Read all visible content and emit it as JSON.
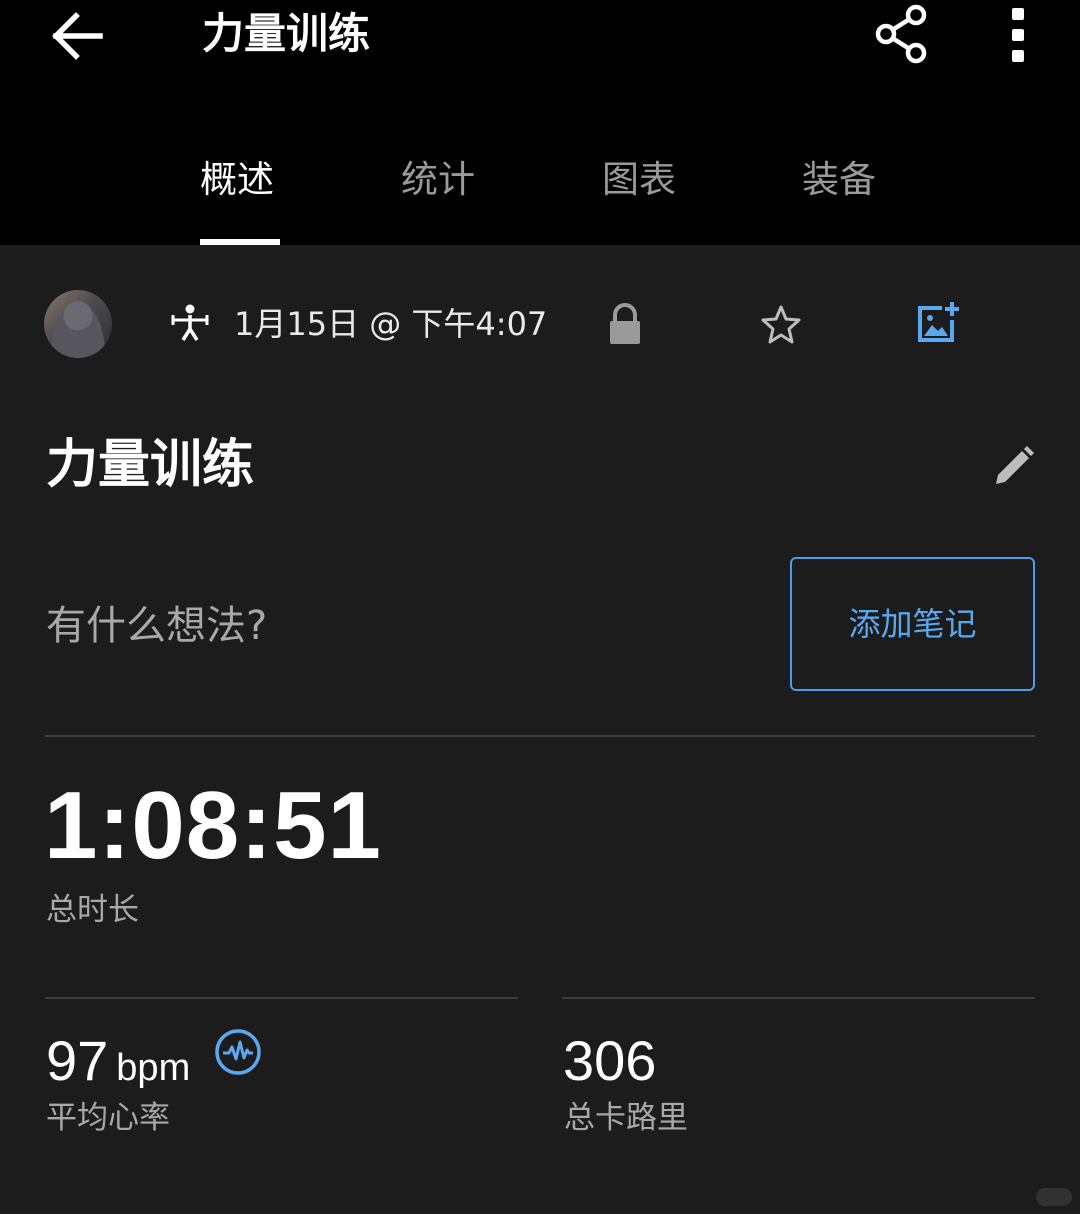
{
  "header": {
    "title": "力量训练",
    "icons": {
      "back": "arrow-left-icon",
      "share": "share-icon",
      "more": "more-vertical-icon"
    }
  },
  "tabs": [
    {
      "label": "概述",
      "active": true
    },
    {
      "label": "统计",
      "active": false
    },
    {
      "label": "图表",
      "active": false
    },
    {
      "label": "装备",
      "active": false
    }
  ],
  "meta": {
    "activity_icon": "strength-training-icon",
    "date": "1月15日 @ 下午4:07",
    "privacy_icon": "lock-icon",
    "favorite_icon": "star-outline-icon",
    "add_photo_icon": "add-photo-icon"
  },
  "activity": {
    "title": "力量训练",
    "edit_icon": "pencil-icon"
  },
  "notes": {
    "prompt": "有什么想法?",
    "add_button_label": "添加笔记"
  },
  "stats": {
    "duration": {
      "value": "1:08:51",
      "label": "总时长"
    },
    "heart_rate": {
      "value": "97",
      "unit": "bpm",
      "label": "平均心率",
      "icon": "heart-rate-icon"
    },
    "calories": {
      "value": "306",
      "label": "总卡路里"
    }
  },
  "colors": {
    "background": "#1c1c1c",
    "header_background": "#000000",
    "accent_blue": "#4c9be8",
    "secondary_text": "#a8a8a8",
    "divider": "#3e3e3e"
  }
}
